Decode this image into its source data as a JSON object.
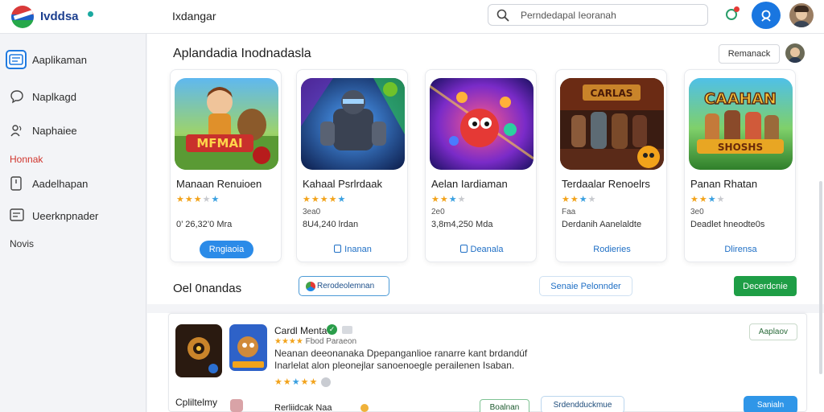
{
  "app": {
    "name": "Ivddsa",
    "page_title": "Ixdangar"
  },
  "search": {
    "placeholder": "Perndedapal Ieoranah"
  },
  "sidebar": {
    "items": [
      {
        "label": "Aaplikaman",
        "icon": "app-window-icon",
        "active": true
      },
      {
        "label": "Naplkagd",
        "icon": "chat-bubble-icon"
      },
      {
        "label": "Naphaiee",
        "icon": "people-icon"
      },
      {
        "label": "Aadelhapan",
        "icon": "document-icon"
      },
      {
        "label": "Ueerknpnader",
        "icon": "list-icon"
      }
    ],
    "section_label": "Honnak",
    "footer_label": "Novis"
  },
  "main": {
    "section_title": "Aplandadia Inodnadasla",
    "recommend_label": "Remanack",
    "cards": [
      {
        "name": "Manaan Renuioen",
        "rating": 3,
        "meta": "",
        "size": "0’ 26,32’0 Mra",
        "action": "Rngiaoia",
        "action_style": "filled"
      },
      {
        "name": "Kahaal Psrlrdaak",
        "rating": 3.5,
        "meta": "3ea0",
        "size": "8U4,240 lrdan",
        "action": "Inanan",
        "action_style": "link"
      },
      {
        "name": "Aelan Iardiaman",
        "rating": 3,
        "meta": "2e0",
        "size": "3,8m4,250 Mda",
        "action": "Deanala",
        "action_style": "link"
      },
      {
        "name": "Terdaalar Renoelrs",
        "rating": 2.5,
        "meta": "Faa",
        "size": "Derdanih Aanelaldte",
        "action": "Rodieries",
        "action_style": "link"
      },
      {
        "name": "Panan Rhatan",
        "rating": 3,
        "meta": "3e0",
        "size": "Deadlet hneodte0s",
        "action": "Dlirensa",
        "action_style": "link"
      }
    ]
  },
  "row2": {
    "title": "Oel 0nandas",
    "chip_label": "Rerodeolemnan",
    "plain_label": "Senaie Pelonnder",
    "green_label": "Decerdcnie"
  },
  "panel": {
    "title": "Cardl Menta",
    "verified": "✓",
    "sub": "Fbod Paraeon",
    "sub_stars": "★★★★",
    "desc_line1": "Neanan deeonanaka Dpepanganlioe ranarre kant brdandúf",
    "desc_line2": "Inarlelat alon pleonejlar sanoenoegle perailenen Isaban.",
    "rating_stars": "★★☆★★",
    "approve_label": "Aaplaov",
    "footer_label": "Cpliltelmy",
    "footer_text": "Rerliidcak Naa",
    "btn1": "Boalnan",
    "btn2": "Srdendduckmue",
    "btn3": "Sanialn"
  },
  "colors": {
    "accent": "#1f7ae0",
    "green": "#1e9e46",
    "star": "#f2a31b"
  }
}
